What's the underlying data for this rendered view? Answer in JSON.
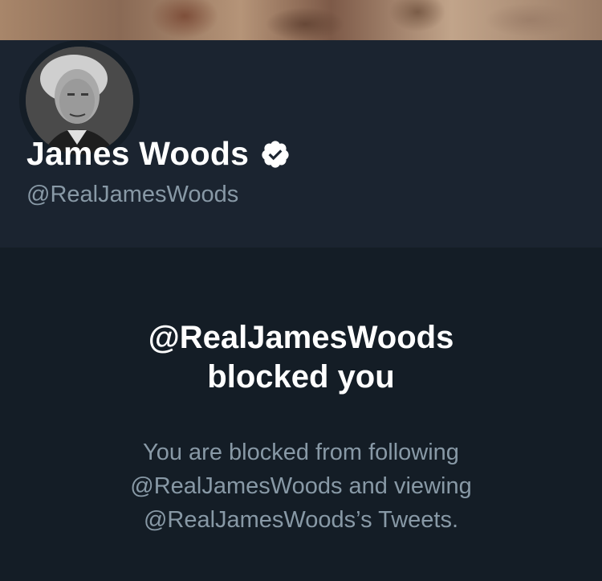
{
  "profile": {
    "display_name": "James Woods",
    "handle": "@RealJamesWoods",
    "verified": true
  },
  "blocked": {
    "title_line1": "@RealJamesWoods",
    "title_line2": "blocked you",
    "desc_line1": "You are blocked from following",
    "desc_line2": "@RealJamesWoods and viewing",
    "desc_line3": "@RealJamesWoods’s Tweets."
  },
  "icons": {
    "verified": "verified-badge-icon",
    "avatar": "profile-photo"
  },
  "colors": {
    "background": "#141d26",
    "header_background": "#1b2430",
    "primary_text": "#ffffff",
    "secondary_text": "#8899a6"
  }
}
